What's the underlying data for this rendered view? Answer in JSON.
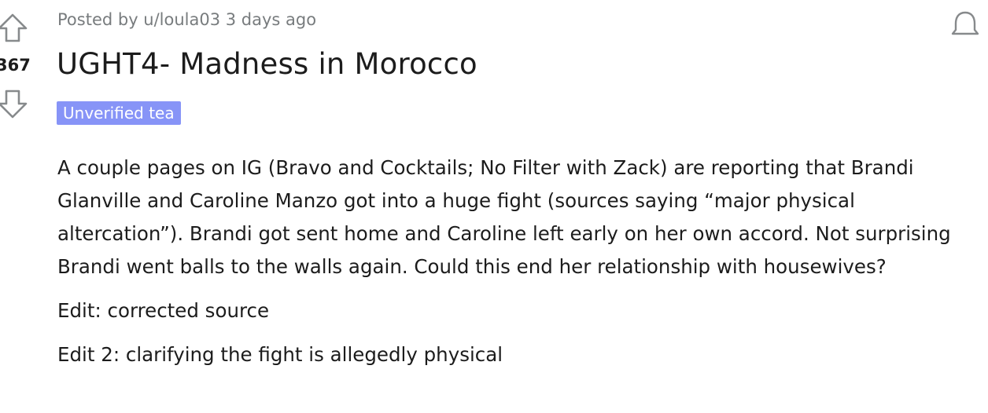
{
  "post": {
    "meta": "Posted by u/loula03 3 days ago",
    "score": "367",
    "title": "UGHT4- Madness in Morocco",
    "flair": "Unverified tea",
    "flair_color": "#8794f7",
    "paragraphs": [
      "A couple pages on IG (Bravo and Cocktails; No Filter with Zack) are reporting that Brandi Glanville and Caroline Manzo got into a huge fight (sources saying “major physical altercation”). Brandi got sent home and Caroline left early on her own accord. Not surprising Brandi went balls to the walls again. Could this end her relationship with housewives?",
      "Edit: corrected source",
      "Edit 2: clarifying the fight is allegedly physical"
    ]
  },
  "icons": {
    "upvote": "upvote-arrow-icon",
    "downvote": "downvote-arrow-icon",
    "notifications": "bell-icon"
  },
  "colors": {
    "meta_text": "#787c7e",
    "body_text": "#1c1c1c",
    "arrow": "#878a8c"
  }
}
